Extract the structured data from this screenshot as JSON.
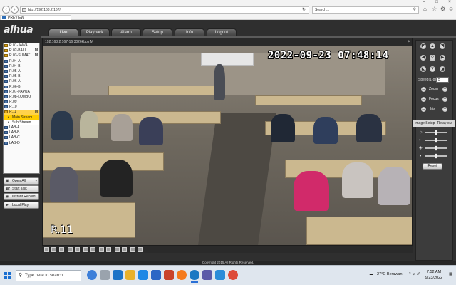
{
  "browser": {
    "address": "http://192.168.2.167/",
    "search_placeholder": "Search...",
    "tab_title": "PREVIEW"
  },
  "app": {
    "logo": "alhua",
    "menu": [
      {
        "label": "Live"
      },
      {
        "label": "Playback"
      },
      {
        "label": "Alarm"
      },
      {
        "label": "Setup"
      },
      {
        "label": "Info"
      },
      {
        "label": "Logout"
      }
    ],
    "channels": [
      {
        "label": "R.01-JAWA",
        "marker": "",
        "on": true
      },
      {
        "label": "R.02-BALI",
        "marker": "M",
        "on": true
      },
      {
        "label": "R.03-SUMAT",
        "marker": "M",
        "on": true
      },
      {
        "label": "R.04-A",
        "marker": "",
        "on": false
      },
      {
        "label": "R.04-B",
        "marker": "",
        "on": false
      },
      {
        "label": "R.05-A",
        "marker": "",
        "on": false
      },
      {
        "label": "R.05-B",
        "marker": "",
        "on": false
      },
      {
        "label": "R.06-A",
        "marker": "",
        "on": false
      },
      {
        "label": "R.06-B",
        "marker": "",
        "on": false
      },
      {
        "label": "R.07-PAPUA",
        "marker": "",
        "on": false
      },
      {
        "label": "R.08-LOMBO",
        "marker": "",
        "on": false
      },
      {
        "label": "R.09",
        "marker": "",
        "on": false
      },
      {
        "label": "R.10",
        "marker": "",
        "on": false
      },
      {
        "label": "R.11",
        "marker": "M",
        "on": true,
        "selected": true
      },
      {
        "label": "Main Stream",
        "sub": true,
        "on": true
      },
      {
        "label": "Sub Stream",
        "sub": true,
        "on": false
      },
      {
        "label": "LAB-A",
        "marker": "",
        "on": false
      },
      {
        "label": "LAB-B",
        "marker": "",
        "on": false
      },
      {
        "label": "LAB-C",
        "marker": "",
        "on": false
      },
      {
        "label": "LAB-D",
        "marker": "",
        "on": false
      }
    ],
    "side_buttons": {
      "open_all": "Open All",
      "start_talk": "Start Talk",
      "instant_record": "Instant Record",
      "local_play": "Local Play"
    },
    "video": {
      "info": "192.168.2.167-16 3026kbps M",
      "timestamp": "2022-09-23 07:48:14",
      "camera_name": "R.11"
    },
    "ptz": {
      "speed_label": "Speed(1-8)",
      "speed_value": "5",
      "zoom": "Zoom",
      "focus": "Focus",
      "iris": "Iris"
    },
    "image_setup": {
      "title": "Image Setup",
      "relay": "Relay-out",
      "reset": "Reset"
    },
    "footer": "Copyright 2015 All Rights Reserved."
  },
  "taskbar": {
    "search_placeholder": "Type here to search",
    "weather": "27°C Berawan",
    "time": "7:52 AM",
    "date": "9/23/2022"
  }
}
